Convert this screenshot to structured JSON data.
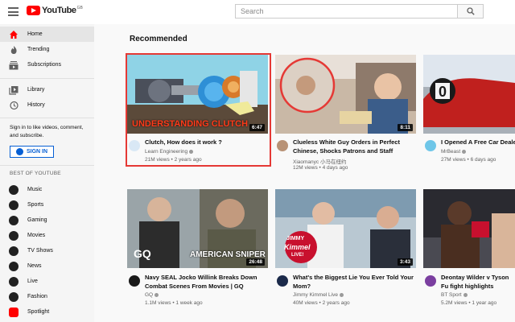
{
  "header": {
    "logo_text": "YouTube",
    "logo_region": "GB",
    "search_placeholder": "Search",
    "icons": [
      "menu-icon",
      "search-icon"
    ]
  },
  "sidebar": {
    "primary": [
      {
        "label": "Home",
        "icon": "home-icon",
        "active": true
      },
      {
        "label": "Trending",
        "icon": "flame-icon"
      },
      {
        "label": "Subscriptions",
        "icon": "subscriptions-icon"
      }
    ],
    "secondary": [
      {
        "label": "Library",
        "icon": "library-icon"
      },
      {
        "label": "History",
        "icon": "history-icon"
      }
    ],
    "signin_prompt": "Sign in to like videos, comment, and subscribe.",
    "signin_button": "SIGN IN",
    "best_of_title": "BEST OF YOUTUBE",
    "best_of": [
      {
        "label": "Music",
        "icon": "music-icon"
      },
      {
        "label": "Sports",
        "icon": "sports-icon"
      },
      {
        "label": "Gaming",
        "icon": "gaming-icon"
      },
      {
        "label": "Movies",
        "icon": "movies-icon"
      },
      {
        "label": "TV Shows",
        "icon": "tv-icon"
      },
      {
        "label": "News",
        "icon": "news-icon"
      },
      {
        "label": "Live",
        "icon": "live-icon"
      },
      {
        "label": "Fashion",
        "icon": "fashion-icon"
      },
      {
        "label": "Spotlight",
        "icon": "spotlight-icon"
      }
    ]
  },
  "main": {
    "section_title": "Recommended",
    "videos": [
      {
        "title": "Clutch, How does it work ?",
        "channel": "Learn Engineering",
        "meta": "21M views • 2 years ago",
        "duration": "6:47",
        "thumb_text": "UNDERSTANDING CLUTCH",
        "selected": true
      },
      {
        "title": "Clueless White Guy Orders in Perfect Chinese, Shocks Patrons and Staff",
        "channel": "Xiaomanyc 小马在纽约",
        "meta": "12M views • 4 days ago",
        "duration": "8:11"
      },
      {
        "title": "I Opened A Free Car Deale",
        "channel": "MrBeast",
        "meta": "27M views • 6 days ago",
        "duration": ""
      },
      {
        "title": "Navy SEAL Jocko Willink Breaks Down Combat Scenes From Movies | GQ",
        "channel": "GQ",
        "meta": "1.1M views • 1 week ago",
        "duration": "26:48",
        "thumb_text": "AMERICAN SNIPER",
        "logo_text": "GQ"
      },
      {
        "title": "What's the Biggest Lie You Ever Told Your Mom?",
        "channel": "Jimmy Kimmel Live",
        "meta": "40M views • 2 years ago",
        "duration": "3:43",
        "thumb_text": "JIMMY",
        "logo_text": "Kimmel",
        "logo_sub": "LIVE!"
      },
      {
        "title": "Deontay Wilder v Tyson Fu fight highlights",
        "channel": "BT Sport",
        "meta": "5.2M views • 1 year ago",
        "duration": ""
      }
    ]
  },
  "colors": {
    "accent_red": "#ff0000",
    "link_blue": "#065fd4",
    "highlight": "#e53935"
  }
}
